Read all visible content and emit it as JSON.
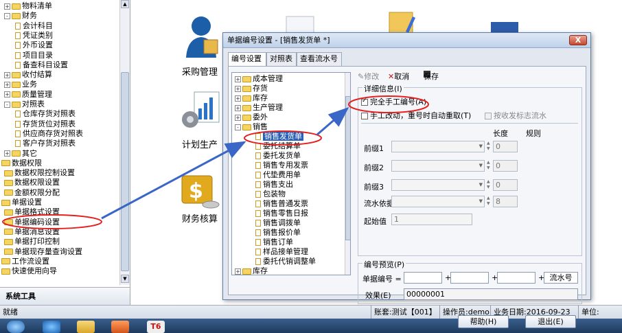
{
  "left_tree": [
    {
      "label": "物料清单",
      "level": 1,
      "type": "folder",
      "exp": "+"
    },
    {
      "label": "财务",
      "level": 1,
      "type": "folder",
      "exp": "-"
    },
    {
      "label": "会计科目",
      "level": 2,
      "type": "doc"
    },
    {
      "label": "凭证类别",
      "level": 2,
      "type": "doc"
    },
    {
      "label": "外币设置",
      "level": 2,
      "type": "doc"
    },
    {
      "label": "项目目录",
      "level": 2,
      "type": "doc"
    },
    {
      "label": "备查科目设置",
      "level": 2,
      "type": "doc"
    },
    {
      "label": "收付结算",
      "level": 1,
      "type": "folder",
      "exp": "+"
    },
    {
      "label": "业务",
      "level": 1,
      "type": "folder",
      "exp": "+"
    },
    {
      "label": "质量管理",
      "level": 1,
      "type": "folder",
      "exp": "+"
    },
    {
      "label": "对照表",
      "level": 1,
      "type": "folder",
      "exp": "-"
    },
    {
      "label": "仓库存货对照表",
      "level": 2,
      "type": "doc"
    },
    {
      "label": "存货货位对照表",
      "level": 2,
      "type": "doc"
    },
    {
      "label": "供应商存货对照表",
      "level": 2,
      "type": "doc"
    },
    {
      "label": "客户存货对照表",
      "level": 2,
      "type": "doc"
    },
    {
      "label": "其它",
      "level": 1,
      "type": "folder",
      "exp": "+"
    },
    {
      "label": "数据权限",
      "level": 0,
      "type": "folder"
    },
    {
      "label": "数据权限控制设置",
      "level": 1,
      "type": "doc-folder"
    },
    {
      "label": "数据权限设置",
      "level": 1,
      "type": "doc-folder"
    },
    {
      "label": "金额权限分配",
      "level": 1,
      "type": "doc-folder"
    },
    {
      "label": "单据设置",
      "level": 0,
      "type": "folder"
    },
    {
      "label": "单据格式设置",
      "level": 1,
      "type": "doc-folder"
    },
    {
      "label": "单据编码设置",
      "level": 1,
      "type": "doc-folder"
    },
    {
      "label": "单据消息设置",
      "level": 1,
      "type": "doc-folder"
    },
    {
      "label": "单据打印控制",
      "level": 1,
      "type": "doc-folder"
    },
    {
      "label": "单据现存量查询设置",
      "level": 1,
      "type": "doc-folder"
    },
    {
      "label": "工作流设置",
      "level": 0,
      "type": "folder"
    },
    {
      "label": "快速使用向导",
      "level": 0,
      "type": "folder"
    }
  ],
  "system_tools_label": "系统工具",
  "desktop": {
    "items": [
      "采购管理",
      "计划生产",
      "财务核算"
    ]
  },
  "status_bar": {
    "ready": "就绪",
    "account": "账套:测试【001】",
    "operator": "操作员:demo",
    "business_date": "业务日期:2016-09-23",
    "unit": "单位:"
  },
  "dialog": {
    "title": "单据编号设置 - [销售发货单 *]",
    "close_label": "X",
    "tabs": [
      "编号设置",
      "对照表",
      "查看流水号"
    ],
    "tree": [
      {
        "label": "成本管理",
        "level": 0,
        "exp": "+",
        "type": "folder"
      },
      {
        "label": "存货",
        "level": 0,
        "exp": "+",
        "type": "folder"
      },
      {
        "label": "库存",
        "level": 0,
        "exp": "+",
        "type": "folder"
      },
      {
        "label": "生产管理",
        "level": 0,
        "exp": "+",
        "type": "folder"
      },
      {
        "label": "委外",
        "level": 0,
        "exp": "+",
        "type": "folder"
      },
      {
        "label": "销售",
        "level": 0,
        "exp": "-",
        "type": "folder"
      },
      {
        "label": "销售发货单",
        "level": 1,
        "type": "doc",
        "selected": true
      },
      {
        "label": "委托结算单",
        "level": 1,
        "type": "doc"
      },
      {
        "label": "委托发货单",
        "level": 1,
        "type": "doc"
      },
      {
        "label": "销售专用发票",
        "level": 1,
        "type": "doc"
      },
      {
        "label": "代垫费用单",
        "level": 1,
        "type": "doc"
      },
      {
        "label": "销售支出",
        "level": 1,
        "type": "doc"
      },
      {
        "label": "包装物",
        "level": 1,
        "type": "doc"
      },
      {
        "label": "销售普通发票",
        "level": 1,
        "type": "doc"
      },
      {
        "label": "销售零售日报",
        "level": 1,
        "type": "doc"
      },
      {
        "label": "销售调拨单",
        "level": 1,
        "type": "doc"
      },
      {
        "label": "销售报价单",
        "level": 1,
        "type": "doc"
      },
      {
        "label": "销售订单",
        "level": 1,
        "type": "doc"
      },
      {
        "label": "样品接单管理",
        "level": 1,
        "type": "doc"
      },
      {
        "label": "委托代销调整单",
        "level": 1,
        "type": "doc"
      },
      {
        "label": "库存",
        "level": 0,
        "exp": "+",
        "type": "folder"
      }
    ],
    "toolbar": {
      "modify": "修改",
      "cancel": "取消",
      "save": "保存"
    },
    "detail_title": "详细信息",
    "detail_title_key": "(I)",
    "check_manual": "完全手工编号(A)",
    "check_retry": "手工改动，重号时自动重取(T)",
    "check_receive": "按收发标志流水",
    "col_length": "长度",
    "col_rule": "规则",
    "prefix1": "前缀1",
    "prefix2": "前缀2",
    "prefix3": "前缀3",
    "prefix_len_value": "0",
    "serial_basis": "流水依据",
    "serial_len_value": "8",
    "start_value_label": "起始值",
    "start_value": "1",
    "preview_title": "编号预览",
    "preview_title_key": "(P)",
    "doc_no_label": "单据编号 =",
    "plus": "+",
    "serial_label": "流水号",
    "effect_label": "效果(E)",
    "effect_value": "00000001",
    "help_button": "帮助(H)",
    "exit_button": "退出(E)"
  },
  "colors": {
    "annotation": "#e52020",
    "arrow": "#3a66c8",
    "selection": "#2a5fb8"
  }
}
